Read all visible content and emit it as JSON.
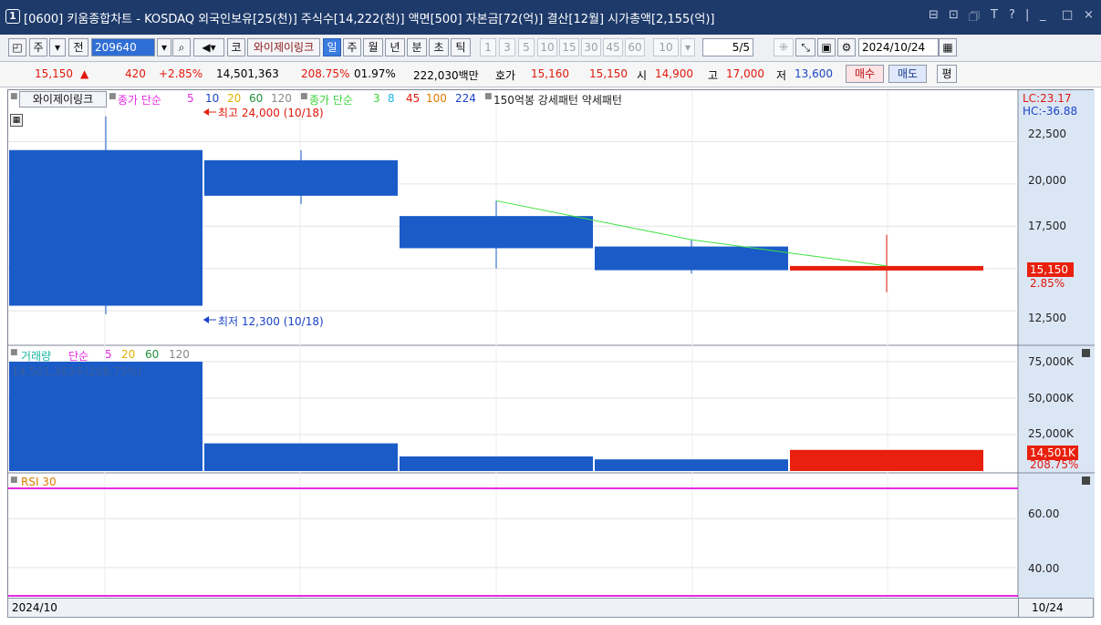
{
  "window": {
    "number": "1",
    "title": "[0600] 키움종합차트 - KOSDAQ 외국인보유[25(천)] 주식수[14,222(천)] 액면[500] 자본금[72(억)] 결산[12월] 시가총액[2,155(억)]",
    "controls": [
      "⊟",
      "⊡",
      "🗇",
      "T",
      "?",
      "|",
      "_",
      "□",
      "×"
    ]
  },
  "toolbar": {
    "period_tab": "주",
    "prev_label": "전",
    "code": "209640",
    "market_label": "코",
    "stock_name": "와이제이링크",
    "periods": [
      "일",
      "주",
      "월",
      "년",
      "분",
      "초",
      "틱"
    ],
    "selected_period": "일",
    "intervals": [
      "1",
      "3",
      "5",
      "10",
      "15",
      "30",
      "45",
      "60",
      "10"
    ],
    "page": "5/5",
    "date": "2024/10/24"
  },
  "quote": {
    "price": "15,150",
    "arrow": "▲",
    "change": "420",
    "change_pct": "+2.85%",
    "volume": "14,501,363",
    "volume_ratio": "208.75%",
    "turnover": "01.97%",
    "amount": "222,030백만",
    "bid_label": "호가",
    "ask": "15,160",
    "bid": "15,150",
    "open_label": "시",
    "open": "14,900",
    "high_label": "고",
    "high": "17,000",
    "low_label": "저",
    "low": "13,600",
    "buy_button": "매수",
    "sell_button": "매도",
    "eval_button": "평"
  },
  "price_legend": {
    "stock_button": "와이제이링크",
    "ma1_label": "종가 단순",
    "ma1_periods": [
      "5",
      "10",
      "20",
      "60",
      "120"
    ],
    "ma2_label": "종가 단순",
    "ma2_periods": [
      "3",
      "8",
      "45",
      "100",
      "224"
    ],
    "ma3_label": "150억봉 강세패턴 약세패턴",
    "high_annotation": "최고 24,000 (10/18)",
    "low_annotation": "최저 12,300 (10/18)",
    "lc": "LC:23.17",
    "hc": "HC:-36.88",
    "price_tag": "15,150",
    "pct_tag": "2.85%"
  },
  "volume_legend": {
    "label": "거래량",
    "ma_label": "단순",
    "periods": [
      "5",
      "20",
      "60",
      "120"
    ],
    "current": "14,501,363주(208.75%)",
    "tag": "14,501K",
    "tag_pct": "208.75%"
  },
  "rsi_legend": {
    "label": "RSI 30"
  },
  "axes": {
    "price_ticks": [
      "22,500",
      "20,000",
      "17,500",
      "12,500"
    ],
    "volume_ticks": [
      "75,000K",
      "50,000K",
      "25,000K"
    ],
    "rsi_ticks": [
      "60.00",
      "40.00"
    ],
    "x_start": "2024/10",
    "x_end": "10/24"
  },
  "colors": {
    "up": "#e8200d",
    "down": "#1a5bc8",
    "ma": "#3ee23e",
    "rsi": "#e52ae5"
  },
  "chart_data": {
    "type": "bar",
    "candles": [
      {
        "open": 22000,
        "high": 24000,
        "low": 12300,
        "close": 12800
      },
      {
        "open": 21400,
        "high": 22000,
        "low": 18800,
        "close": 19300
      },
      {
        "open": 18100,
        "high": 19000,
        "low": 15000,
        "close": 16200
      },
      {
        "open": 16300,
        "high": 16700,
        "low": 14700,
        "close": 14900
      },
      {
        "open": 14900,
        "high": 17000,
        "low": 13600,
        "close": 15150
      }
    ],
    "ma3": [
      null,
      null,
      19000,
      16700,
      15150
    ],
    "volume": [
      75000,
      19000,
      10000,
      8000,
      14501
    ],
    "rsi": [],
    "price_range": [
      11000,
      25000
    ],
    "volume_range": [
      0,
      80000
    ],
    "rsi_range": [
      28,
      78
    ]
  }
}
